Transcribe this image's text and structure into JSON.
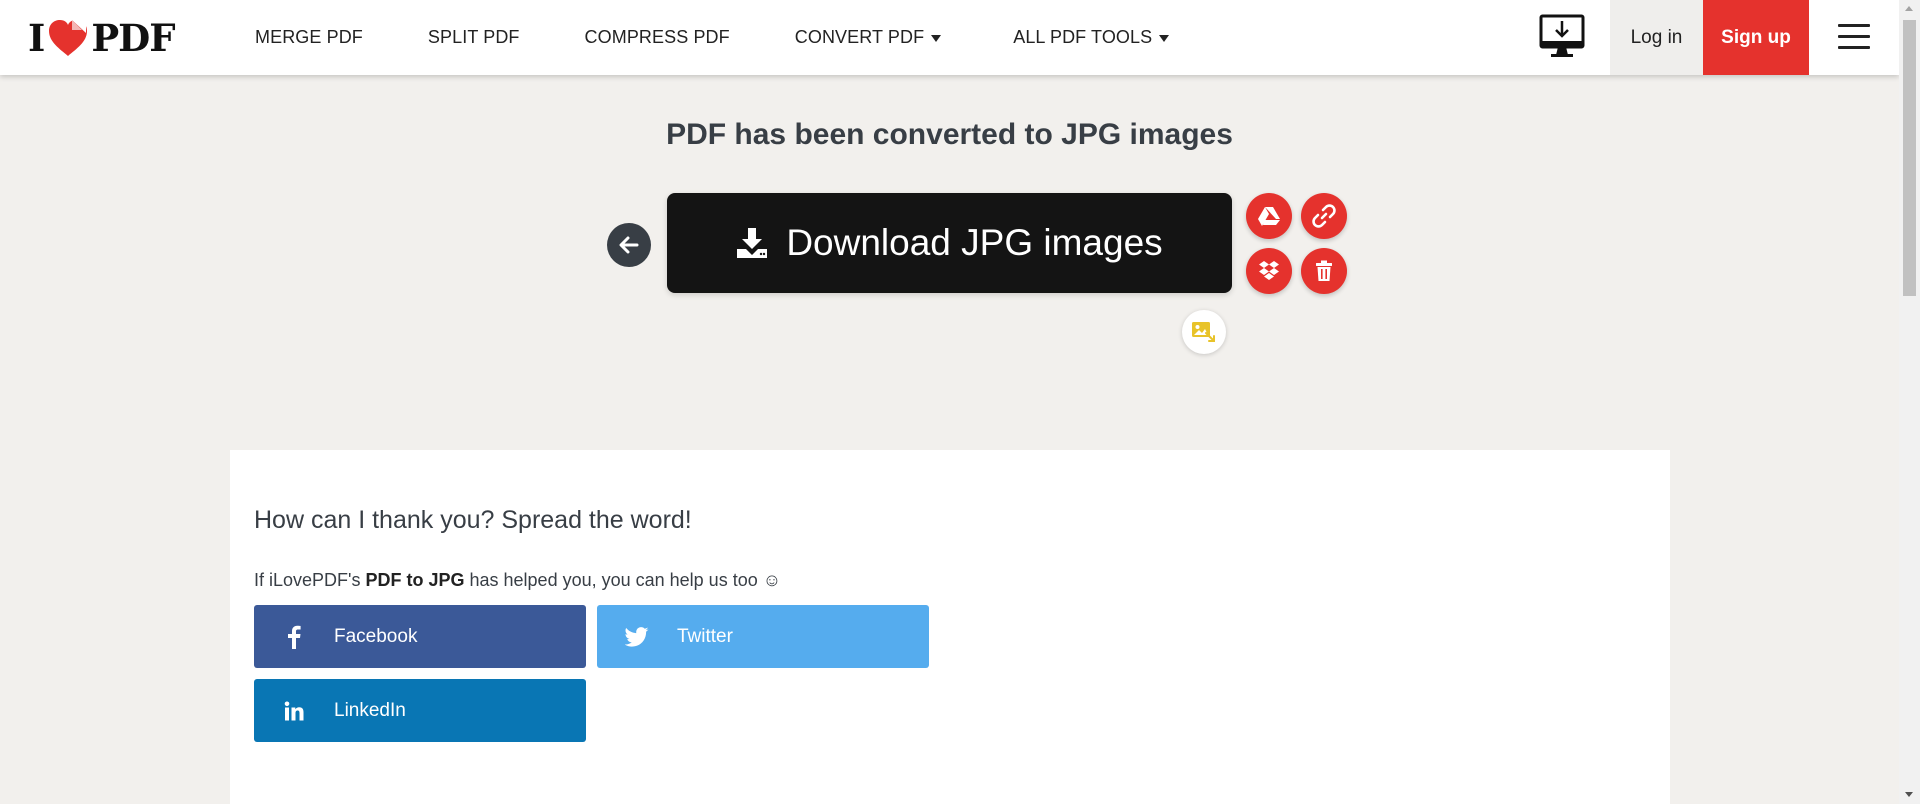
{
  "header": {
    "logo": {
      "left": "I",
      "right": "PDF"
    },
    "nav": [
      {
        "label": "MERGE PDF",
        "dropdown": false
      },
      {
        "label": "SPLIT PDF",
        "dropdown": false
      },
      {
        "label": "COMPRESS PDF",
        "dropdown": false
      },
      {
        "label": "CONVERT PDF",
        "dropdown": true
      },
      {
        "label": "ALL PDF TOOLS",
        "dropdown": true
      }
    ],
    "login_label": "Log in",
    "signup_label": "Sign up"
  },
  "main": {
    "title": "PDF has been converted to JPG images",
    "download_label": "Download JPG images"
  },
  "share": {
    "heading": "How can I thank you? Spread the word!",
    "text_before": "If iLovePDF's ",
    "text_bold": "PDF to JPG",
    "text_after": " has helped you, you can help us too ☺",
    "buttons": {
      "facebook": "Facebook",
      "twitter": "Twitter",
      "linkedin": "LinkedIn"
    }
  },
  "colors": {
    "brand_red": "#e5322d",
    "dark": "#141414",
    "background": "#f2f0ed",
    "facebook": "#3b5998",
    "twitter": "#55acee",
    "linkedin": "#0976b4"
  }
}
